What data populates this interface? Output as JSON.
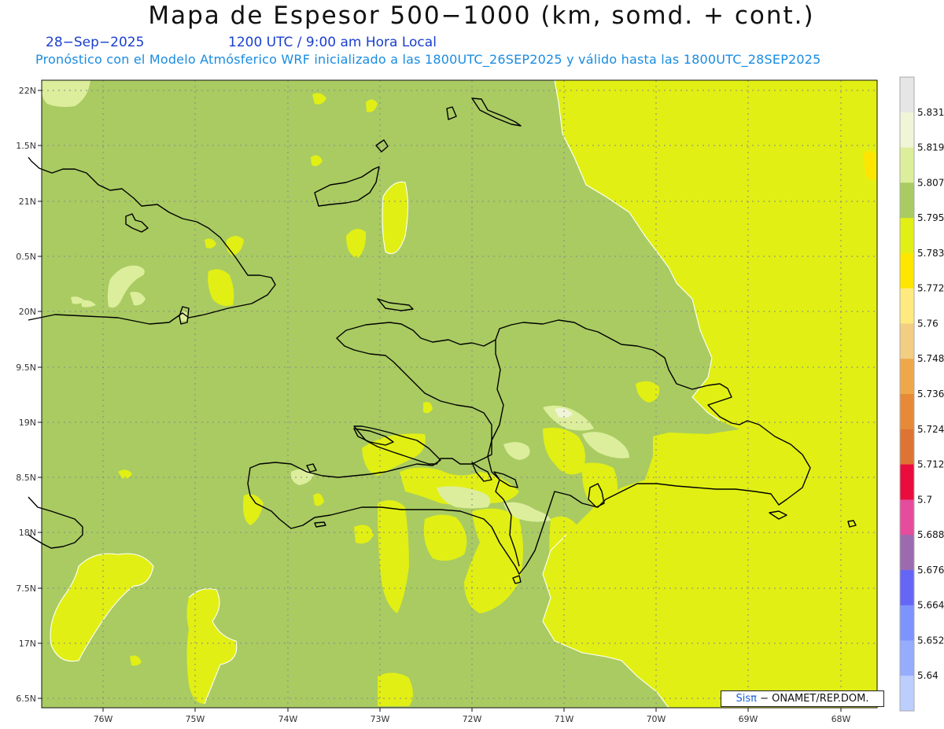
{
  "header": {
    "title": "Mapa de Espesor 500−1000 (km, somd. + cont.)",
    "date": "28−Sep−2025",
    "time": "1200 UTC / 9:00 am Hora Local",
    "subtitle": "Pronóstico con el Modelo Atmósferico WRF inicializado a las 1800UTC_26SEP2025 y válido hasta las  1800UTC_28SEP2025"
  },
  "map": {
    "lat_labels": [
      "22N",
      "1.5N",
      "21N",
      "0.5N",
      "20N",
      "9.5N",
      "19N",
      "8.5N",
      "18N",
      "7.5N",
      "17N",
      "6.5N"
    ],
    "lon_labels": [
      "76W",
      "75W",
      "74W",
      "73W",
      "72W",
      "71W",
      "70W",
      "69W",
      "68W"
    ]
  },
  "colorbar": {
    "labels": [
      "5.831",
      "5.819",
      "5.807",
      "5.795",
      "5.783",
      "5.772",
      "5.76",
      "5.748",
      "5.736",
      "5.724",
      "5.712",
      "5.7",
      "5.688",
      "5.676",
      "5.664",
      "5.652",
      "5.64"
    ],
    "colors": [
      "#e6e6e6",
      "#f0f5d8",
      "#dcee9c",
      "#a9cb62",
      "#e1ef14",
      "#ffe600",
      "#ffea80",
      "#f2ce82",
      "#eea84a",
      "#e68a38",
      "#de7434",
      "#ea0c3c",
      "#e64c9c",
      "#9c6aae",
      "#6666f6",
      "#7d94fe",
      "#95acff",
      "#bccefe"
    ]
  },
  "credit": {
    "brand": "Sisπ",
    "text": "− ONAMET/REP.DOM."
  }
}
